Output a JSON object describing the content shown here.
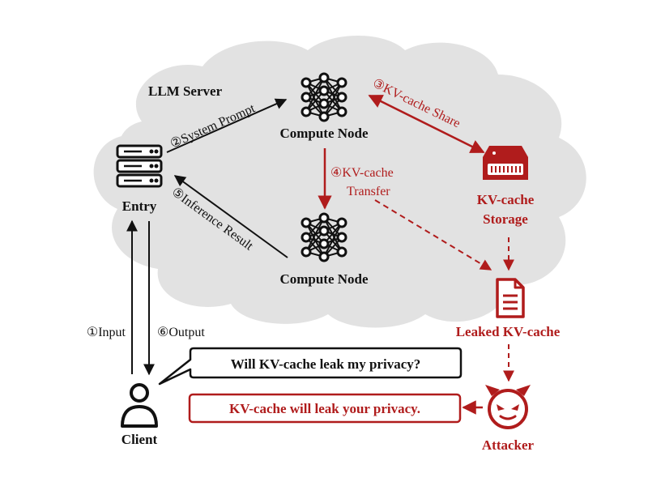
{
  "colors": {
    "cloud": "#e2e2e2",
    "ink": "#111111",
    "accent_red": "#b01c1c"
  },
  "labels": {
    "server_title": "LLM Server",
    "compute_node_top": "Compute Node",
    "compute_node_bottom": "Compute Node",
    "entry": "Entry",
    "kv_storage_line1": "KV-cache",
    "kv_storage_line2": "Storage",
    "leaked": "Leaked KV-cache",
    "client": "Client",
    "attacker": "Attacker"
  },
  "edges": {
    "system_prompt": "②System Prompt",
    "inference_result": "⑤Inference Result",
    "kv_share": "③KV-cache Share",
    "kv_transfer_line1": "④KV-cache",
    "kv_transfer_line2": "Transfer",
    "input": "①Input",
    "output": "⑥Output"
  },
  "bubbles": {
    "client_question": "Will KV-cache leak my privacy?",
    "attacker_answer": "KV-cache will leak your privacy."
  },
  "icons": {
    "server": "server-rack-icon",
    "neural_net": "neural-network-icon",
    "storage": "hard-drive-icon",
    "document": "document-icon",
    "user": "user-icon",
    "devil": "devil-face-icon"
  }
}
